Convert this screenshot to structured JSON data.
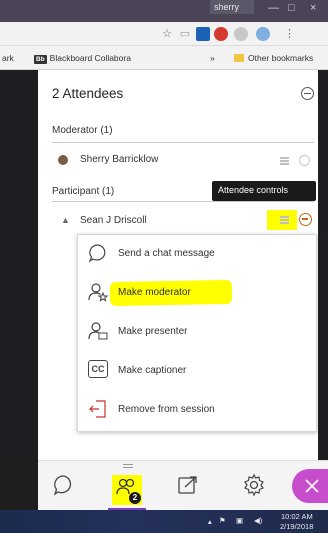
{
  "window": {
    "user_label": "sherry",
    "minimize": "—",
    "maximize": "□",
    "close": "×"
  },
  "bookmarks": {
    "partial_left": "ark",
    "blackboard_badge": "Bb",
    "blackboard_label": "Blackboard Collabora",
    "overflow": "»",
    "other": "Other bookmarks"
  },
  "panel": {
    "title": "2 Attendees",
    "moderator_section": "Moderator (1)",
    "moderator_name": "Sherry Barricklow",
    "participant_section": "Participant (1)",
    "participant_name": "Sean J Driscoll",
    "person_glyph": "▲"
  },
  "tooltip": {
    "text": "Attendee controls"
  },
  "menu": {
    "items": [
      {
        "label": "Send a chat message",
        "icon": "chat-bubble-icon"
      },
      {
        "label": "Make moderator",
        "icon": "user-star-icon"
      },
      {
        "label": "Make presenter",
        "icon": "user-presenter-icon"
      },
      {
        "label": "Make captioner",
        "icon": "cc-icon"
      },
      {
        "label": "Remove from session",
        "icon": "exit-door-icon"
      }
    ],
    "cc_text": "CC"
  },
  "bottomnav": {
    "attendee_badge": "2"
  },
  "taskbar": {
    "time": "10:02 AM",
    "date": "2/19/2018"
  },
  "colors": {
    "highlight": "#ffff00",
    "accent_purple": "#7a3fbf",
    "close_fab": "#c64dcb",
    "tooltip_bg": "#1a1a1a"
  }
}
